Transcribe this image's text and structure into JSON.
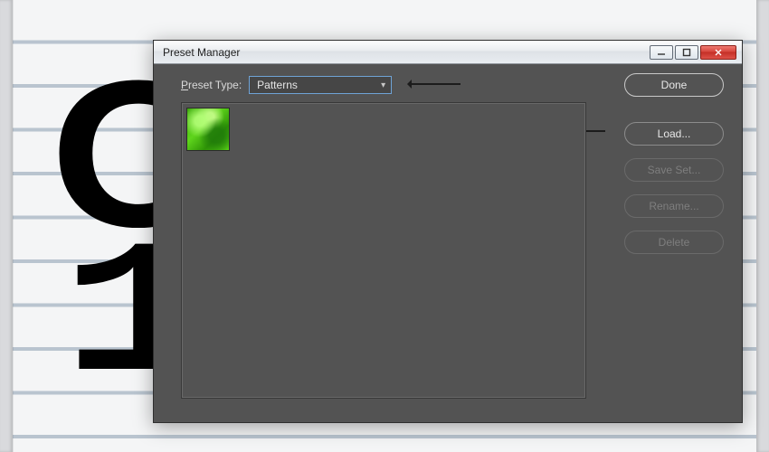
{
  "window": {
    "title": "Preset Manager"
  },
  "toprow": {
    "label_pre": "P",
    "label_rest": "reset Type:",
    "select_value": "Patterns"
  },
  "buttons": {
    "done": "Done",
    "load": "Load...",
    "save_set": "Save Set...",
    "rename": "Rename...",
    "delete": "Delete"
  },
  "swatch": {
    "name": "green-pattern"
  },
  "icons": {
    "gear": "gear-icon",
    "dropdown": "chevron-down-icon",
    "minimize": "minimize-icon",
    "maximize": "maximize-icon",
    "close": "close-icon"
  },
  "background": {
    "letter1": "O",
    "letter2": "1"
  }
}
